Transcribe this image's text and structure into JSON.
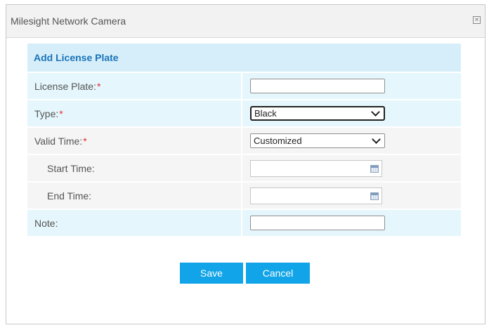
{
  "dialog": {
    "title": "Milesight Network Camera",
    "close_icon": "close-icon"
  },
  "form": {
    "header": "Add License Plate",
    "license_plate": {
      "label": "License Plate:",
      "required_mark": "*",
      "value": ""
    },
    "type": {
      "label": "Type:",
      "required_mark": "*",
      "value": "Black"
    },
    "valid_time": {
      "label": "Valid Time:",
      "required_mark": "*",
      "value": "Customized"
    },
    "start_time": {
      "label": "Start Time:",
      "value": "",
      "icon": "calendar-icon"
    },
    "end_time": {
      "label": "End Time:",
      "value": "",
      "icon": "calendar-icon"
    },
    "note": {
      "label": "Note:",
      "value": ""
    }
  },
  "buttons": {
    "save": "Save",
    "cancel": "Cancel"
  },
  "colors": {
    "accent": "#11a4e8",
    "header_text": "#1a73b8",
    "header_bg": "#d6eefa",
    "required": "#e03030"
  }
}
